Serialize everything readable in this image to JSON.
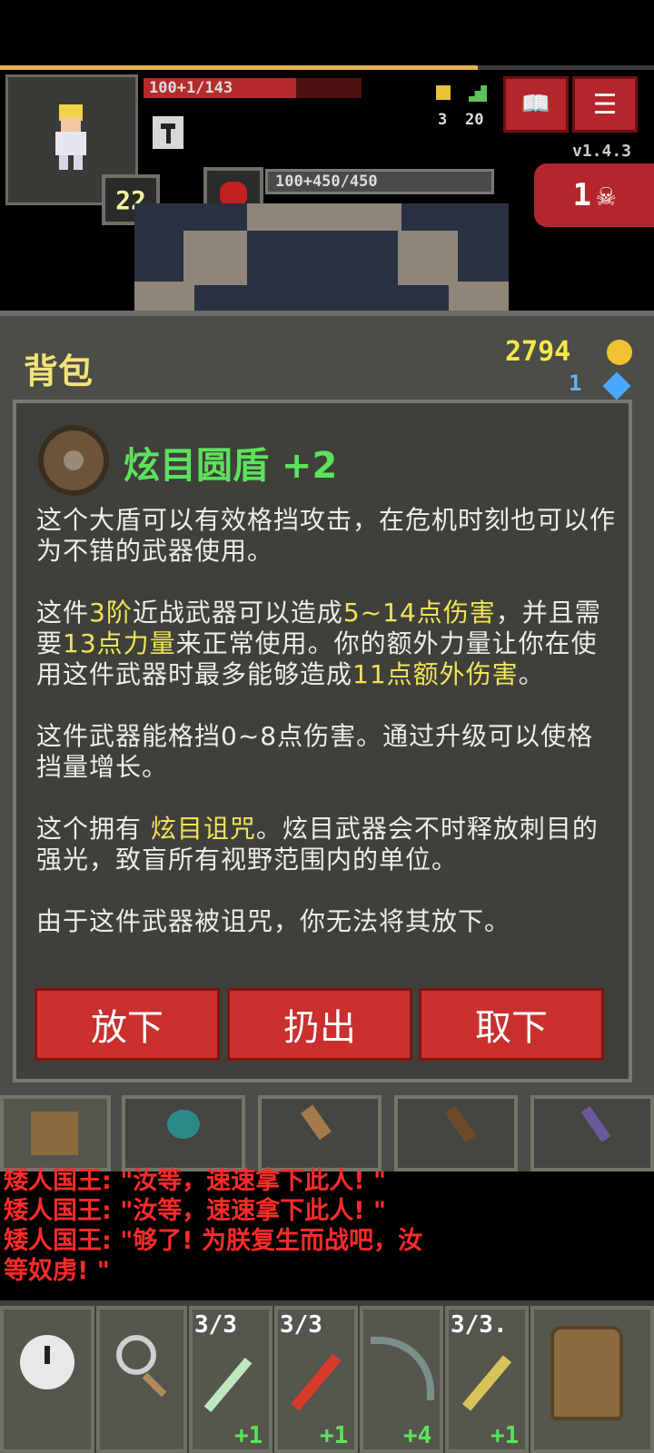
{
  "status": {
    "hp_text": "100+1/143",
    "hp_fraction": 0.7,
    "xp_fraction": 0.73,
    "level": "22",
    "boss_hp_text": "100+450/450",
    "version": "v1.4.3",
    "danger_count": "1",
    "depth": "20",
    "keys": "3"
  },
  "window": {
    "title": "背包",
    "gold": "2794",
    "gems": "1"
  },
  "item": {
    "name": "炫目圆盾 +2",
    "para1": "这个大盾可以有效格挡攻击，在危机时刻也可以作为不错的武器使用。",
    "p2_a": "这件",
    "p2_tier": "3阶",
    "p2_b": "近战武器可以造成",
    "p2_dmg": "5~14点伤害",
    "p2_c": "，并且需要",
    "p2_str": "13点力量",
    "p2_d": "来正常使用。你的额外力量让你在使用这件武器时最多能够造成",
    "p2_extra": "11点额外伤害",
    "p2_e": "。",
    "para3": "这件武器能格挡0~8点伤害。通过升级可以使格挡量增长。",
    "p4_a": "这个拥有 ",
    "p4_curse": "炫目诅咒",
    "p4_b": "。炫目武器会不时释放刺目的强光，致盲所有视野范围内的单位。",
    "para5": "由于这件武器被诅咒，你无法将其放下。"
  },
  "actions": {
    "drop": "放下",
    "throw": "扔出",
    "unequip": "取下"
  },
  "log": [
    "矮人国王: \"汝等，速速拿下此人! \"",
    "矮人国王: \"汝等，速速拿下此人! \"",
    "矮人国王: \"够了! 为朕复生而战吧，汝",
    "等奴虏! \""
  ],
  "quickslots": [
    {
      "count": "3/3",
      "level": "+1"
    },
    {
      "count": "3/3",
      "level": "+1"
    },
    {
      "count": "",
      "level": "+4"
    },
    {
      "count": "3/3.",
      "level": "+1"
    }
  ]
}
